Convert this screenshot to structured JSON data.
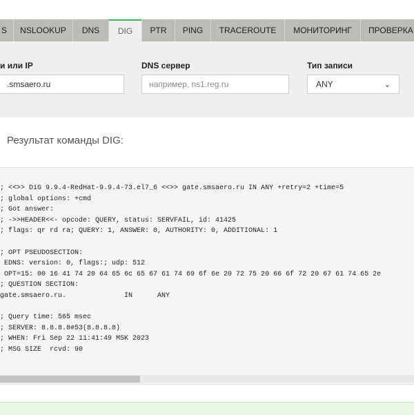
{
  "tabs": [
    {
      "label": "S"
    },
    {
      "label": "NSLOOKUP"
    },
    {
      "label": "DNS"
    },
    {
      "label": "DIG"
    },
    {
      "label": "PTR"
    },
    {
      "label": "PING"
    },
    {
      "label": "TRACEROUTE"
    },
    {
      "label": "МОНИТОРИНГ"
    },
    {
      "label": "ПРОВЕРКА"
    }
  ],
  "active_tab": "DIG",
  "form": {
    "host_label": "и или IP",
    "host_value": ".smsaero.ru",
    "dns_label": "DNS сервер",
    "dns_placeholder": "например, ns1.reg.ru",
    "type_label": "Тип записи",
    "type_value": "ANY"
  },
  "result_title": "Результат команды DIG:",
  "output_lines": [
    "; <<>> DiG 9.9.4-RedHat-9.9.4-73.el7_6 <<>> gate.smsaero.ru IN ANY +retry=2 +time=5",
    "; global options: +cmd",
    "; Got answer:",
    "; ->>HEADER<<- opcode: QUERY, status: SERVFAIL, id: 41425",
    "; flags: qr rd ra; QUERY: 1, ANSWER: 0, AUTHORITY: 0, ADDITIONAL: 1",
    "",
    "; OPT PSEUDOSECTION:",
    " EDNS: version: 0, flags:; udp: 512",
    " OPT=15: 00 16 41 74 20 64 65 6c 65 67 61 74 69 6f 6e 20 72 75 20 66 6f 72 20 67 61 74 65 2e",
    "; QUESTION SECTION:",
    "gate.smsaero.ru.              IN      ANY",
    "",
    "; Query time: 565 msec",
    "; SERVER: 8.8.8.8#53(8.8.8.8)",
    "; WHEN: Fri Sep 22 11:41:49 MSK 2023",
    "; MSG SIZE  rcvd: 90"
  ]
}
